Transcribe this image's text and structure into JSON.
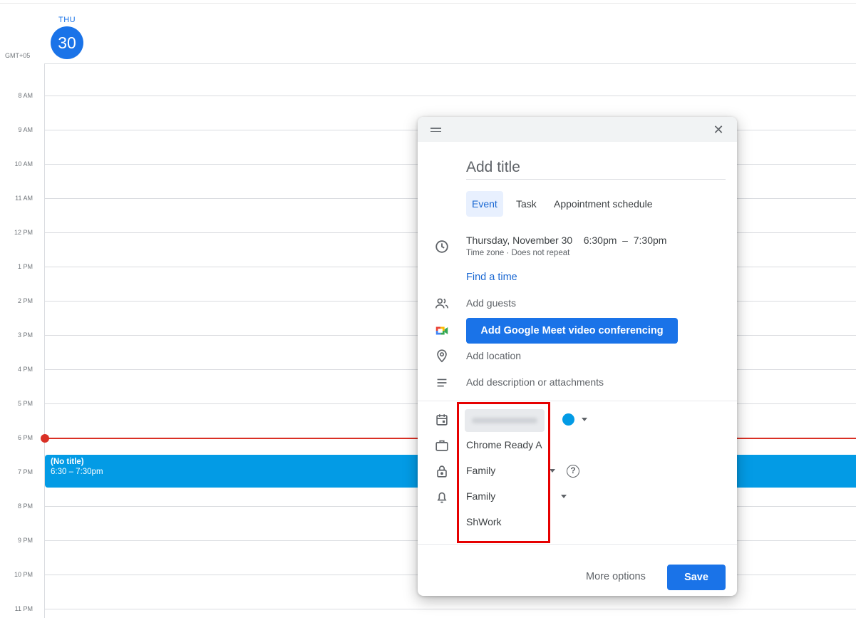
{
  "day_header": {
    "weekday": "THU",
    "date": "30",
    "timezone": "GMT+05"
  },
  "hours": [
    "8 AM",
    "9 AM",
    "10 AM",
    "11 AM",
    "12 PM",
    "1 PM",
    "2 PM",
    "3 PM",
    "4 PM",
    "5 PM",
    "6 PM",
    "7 PM",
    "8 PM",
    "9 PM",
    "10 PM",
    "11 PM"
  ],
  "calendar_event": {
    "title": "(No title)",
    "time": "6:30 – 7:30pm"
  },
  "dialog": {
    "title_placeholder": "Add title",
    "tabs": [
      {
        "label": "Event",
        "active": true
      },
      {
        "label": "Task",
        "active": false
      },
      {
        "label": "Appointment schedule",
        "active": false
      }
    ],
    "date_time": "Thursday, November 30    6:30pm  –  7:30pm",
    "time_zone_repeat": "Time zone · Does not repeat",
    "find_time": "Find a time",
    "add_guests": "Add guests",
    "meet_button": "Add Google Meet video conferencing",
    "add_location": "Add location",
    "add_description": "Add description or attachments",
    "calendar_color": "#039be5",
    "dropdown_items": [
      "Chrome Ready A",
      "Family",
      "Family",
      "ShWork"
    ],
    "more_options": "More options",
    "save": "Save"
  }
}
